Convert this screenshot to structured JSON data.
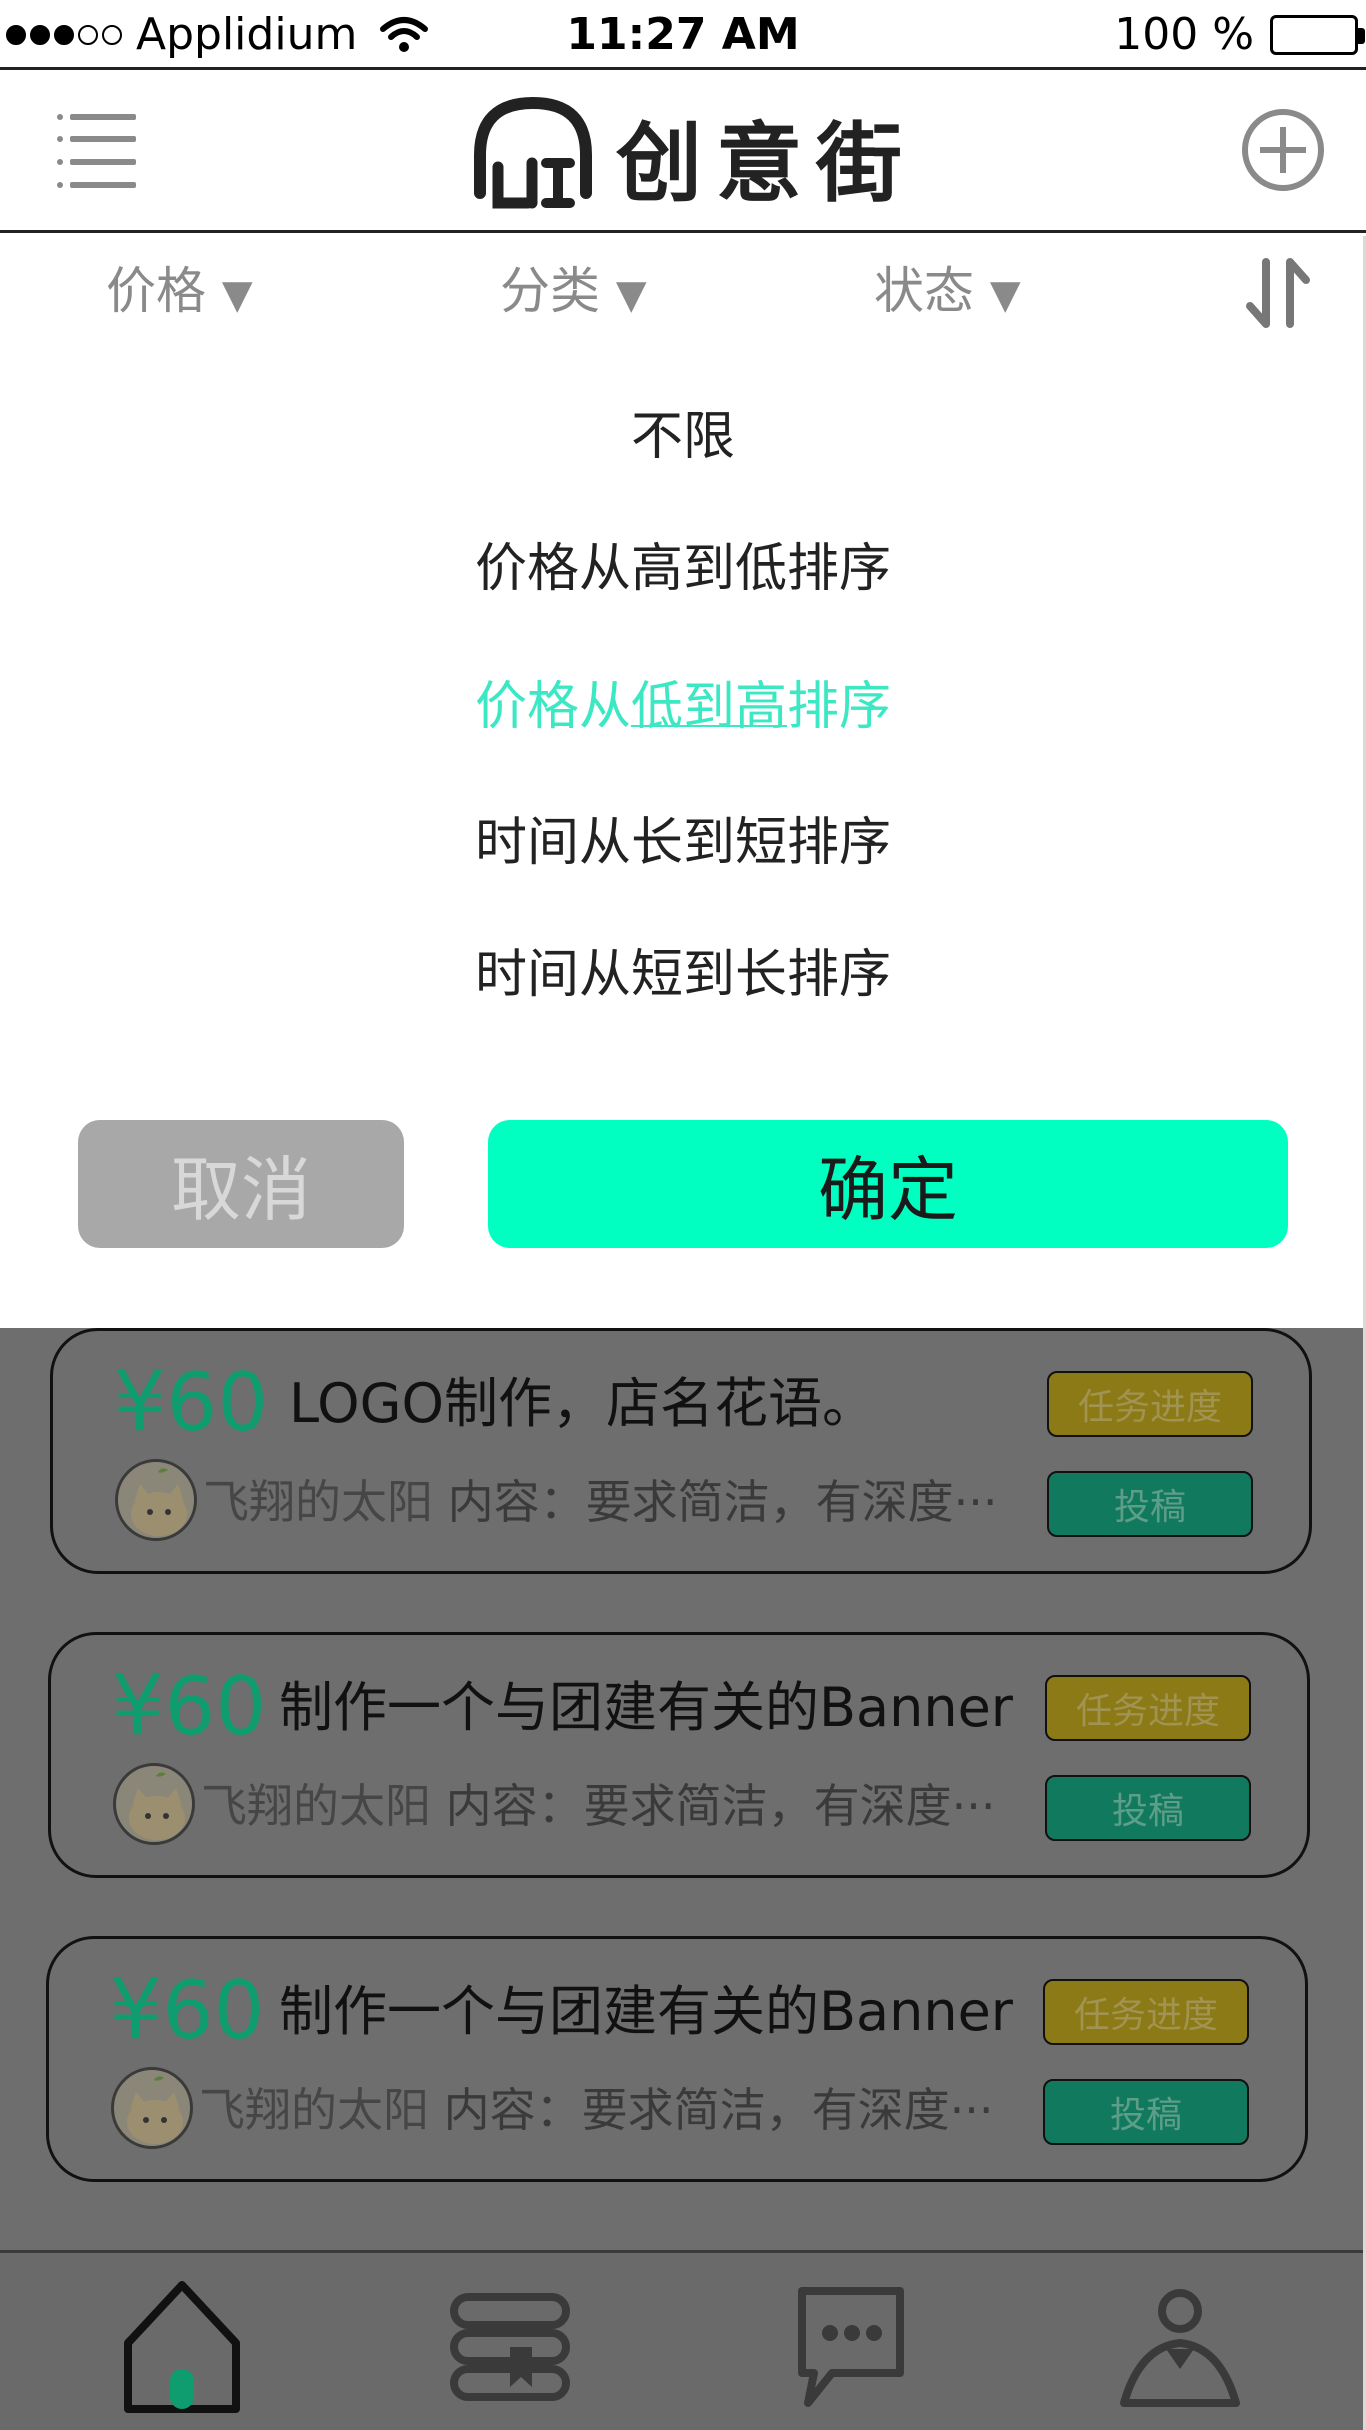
{
  "status_bar": {
    "carrier": "Applidium",
    "time": "11:27 AM",
    "battery": "100 %"
  },
  "header": {
    "brand_name": "创意街",
    "menu_icon": "menu-icon",
    "add_icon": "add-circle-icon"
  },
  "filters": {
    "price": "价格",
    "category": "分类",
    "status": "状态",
    "arrow": "▼",
    "sort_icon": "sort-icon"
  },
  "sort_panel": {
    "options": [
      {
        "pre": "不限",
        "mid": "",
        "post": ""
      },
      {
        "pre": "价格从高到低排序",
        "mid": "",
        "post": ""
      },
      {
        "pre": "价格从",
        "mid": "低到高",
        "post": "排序"
      },
      {
        "pre": "时间从长到短排序",
        "mid": "",
        "post": ""
      },
      {
        "pre": "时间从短到长排序",
        "mid": "",
        "post": ""
      }
    ],
    "selected_index": 2,
    "cancel_label": "取消",
    "confirm_label": "确定",
    "accent_color": "#00ffc0",
    "selected_color": "#3be8c3"
  },
  "tasks": [
    {
      "price": "60",
      "currency": "¥",
      "title": "LOGO制作，店名花语。",
      "user": "飞翔的太阳",
      "content": "内容：要求简洁，有深度···",
      "progress_label": "任务进度",
      "submit_label": "投稿"
    },
    {
      "price": "60",
      "currency": "¥",
      "title": "制作一个与团建有关的Banner",
      "user": "飞翔的太阳",
      "content": "内容：要求简洁，有深度···",
      "progress_label": "任务进度",
      "submit_label": "投稿"
    },
    {
      "price": "60",
      "currency": "¥",
      "title": "制作一个与团建有关的Banner",
      "user": "飞翔的太阳",
      "content": "内容：要求简洁，有深度···",
      "progress_label": "任务进度",
      "submit_label": "投稿"
    }
  ],
  "tab_bar": {
    "tabs": [
      "home-icon",
      "books-icon",
      "chat-icon",
      "profile-icon"
    ],
    "active_index": 0
  }
}
